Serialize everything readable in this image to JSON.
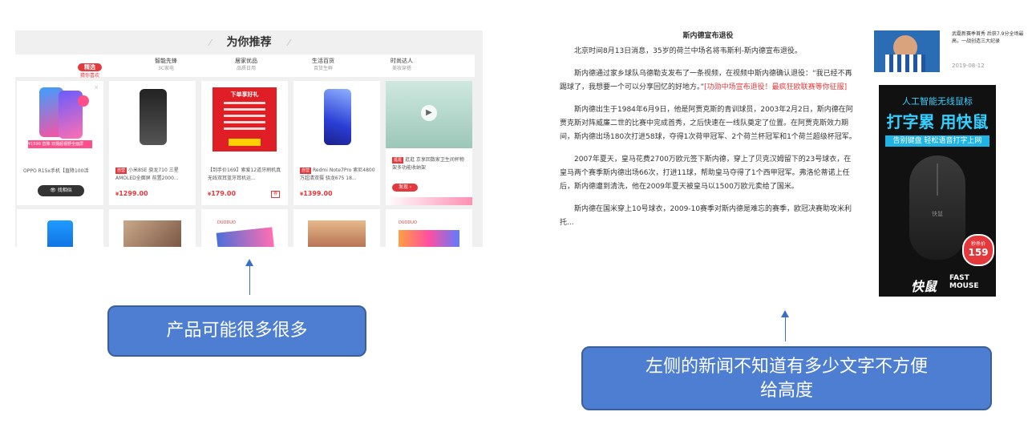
{
  "left_panel": {
    "title": "为你推荐",
    "tabs": [
      {
        "name": "精选",
        "sub": "猜你喜欢"
      },
      {
        "name": "智能先锋",
        "sub": "3C家电"
      },
      {
        "name": "居家优品",
        "sub": "品质日用"
      },
      {
        "name": "生活百货",
        "sub": "百货生鲜"
      },
      {
        "name": "时尚达人",
        "sub": "美妆穿搭"
      }
    ],
    "products": [
      {
        "title": "OPPO R15x手机【直降100活",
        "tag": "",
        "price": "",
        "button": "找相似",
        "badge_price": "¥1599",
        "promo_text": "直降 双摄超视野全面屏"
      },
      {
        "title": "小米8SE 骁龙710 三星AMOLED全面屏 前置2000...",
        "tag": "自营",
        "price": "1299.00",
        "button": "",
        "badge_price": "",
        "promo_text": ""
      },
      {
        "title": "【到手价169】索爱12道牙刷机真无线双耳蓝牙耳机运...",
        "tag": "",
        "price": "179.00",
        "button": "",
        "badge_price": "",
        "promo_text": "下单享好礼",
        "coupon": "券"
      },
      {
        "title": "Redmi Note7Pro 索尼4800万超清双摄 骁龙675 18...",
        "tag": "自营",
        "price": "1399.00",
        "button": "",
        "badge_price": "",
        "promo_text": ""
      },
      {
        "title": "逛逛 京享回数家卫生间杯物架多功能收纳架",
        "tag": "逛逛",
        "price": "",
        "button": "发现",
        "badge_price": "",
        "promo_text": ""
      }
    ],
    "second_row_label": "DUODUO"
  },
  "callout_left": {
    "text": "产品可能很多很多"
  },
  "news": {
    "headline": "斯内德宣布退役",
    "paragraphs": [
      "北京时间8月13日消息，35岁的荷兰中场名将韦斯利-斯内德宣布退役。",
      "斯内德通过家乡球队乌德勒支发布了一条视频，在视频中斯内德确认退役：“我已经不再踢球了，我想要一个可以分享回忆的好地方。”",
      "斯内德出生于1984年6月9日，他是阿贾克斯的青训球员，2003年2月2日，斯内德在阿贾克斯对阵威廉二世的比赛中完成首秀，之后快速在一线队奠定了位置。在阿贾克斯效力期间，斯内德出场180次打进58球，夺得1次荷甲冠军、2个荷兰杯冠军和1个荷兰超级杯冠军。",
      "2007年夏天，皇马花费2700万欧元签下斯内德，穿上了贝克汉姆留下的23号球衣，在皇马两个赛季斯内德出场66次，打进11球，帮助皇马夺得了1个西甲冠军。弗洛伦蒂诺上任后，斯内德遭到清洗，他在2009年夏天被皇马以1500万欧元卖给了国米。",
      "斯内德在国米穿上10号球衣，2009-10赛季对斯内德是难忘的赛季，欧冠决赛助攻米利托..."
    ],
    "link_text": "[功勋中场宣布退役！最疯狂欧联赛等你征服]"
  },
  "side_news": {
    "text": "武磊新赛季首秀 后获7.9分全场最高，一战创造三大纪录",
    "date": "2019-08-12"
  },
  "ad": {
    "line1": "人工智能无线鼠标",
    "line2": "打字累 用快鼠",
    "line3": "告别键盘 轻松语音打字上网",
    "badge_label": "秒杀价",
    "badge_price": "159",
    "brand_cn": "快鼠",
    "brand_en1": "FAST",
    "brand_en2": "MOUSE"
  },
  "callout_right": {
    "line1": "左侧的新闻不知道有多少文字不方便",
    "line2": "给高度"
  },
  "colors": {
    "accent": "#e4393c",
    "callout_bg": "#4e7ed1",
    "arrow": "#3a6fc4"
  }
}
